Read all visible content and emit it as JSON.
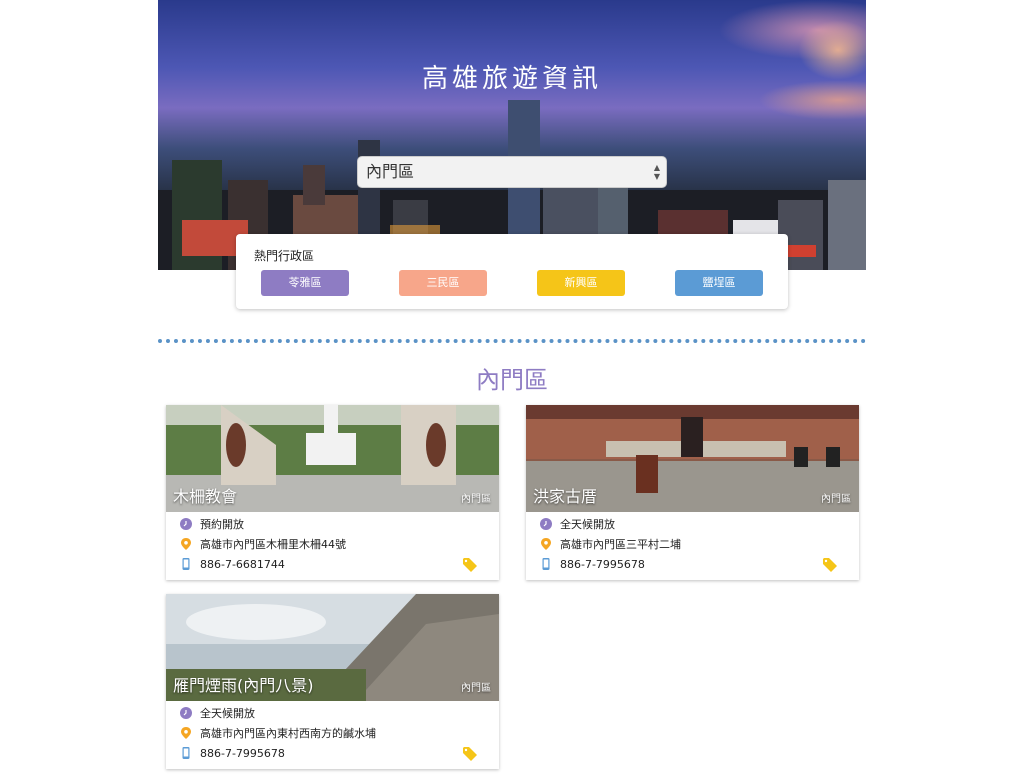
{
  "header": {
    "title": "高雄旅遊資訊",
    "district_select": {
      "selected": "內門區"
    }
  },
  "hot_districts": {
    "title": "熱門行政區",
    "buttons": [
      {
        "label": "苓雅區",
        "color": "#8e7cc3"
      },
      {
        "label": "三民區",
        "color": "#f7a68a"
      },
      {
        "label": "新興區",
        "color": "#f5c518"
      },
      {
        "label": "鹽埕區",
        "color": "#5b9bd5"
      }
    ]
  },
  "section": {
    "title": "內門區"
  },
  "spots": [
    {
      "name": "木柵教會",
      "district": "內門區",
      "open": "預約開放",
      "address": "高雄市內門區木柵里木柵44號",
      "phone": "886-7-6681744"
    },
    {
      "name": "洪家古厝",
      "district": "內門區",
      "open": "全天候開放",
      "address": "高雄市內門區三平村二埔",
      "phone": "886-7-7995678"
    },
    {
      "name": "雁門煙雨(內門八景)",
      "district": "內門區",
      "open": "全天候開放",
      "address": "高雄市內門區內東村西南方的鹹水埔",
      "phone": "886-7-7995678"
    }
  ],
  "colors": {
    "clock": "#8e7cc3",
    "pin": "#f5a623",
    "phone": "#5b9bd5",
    "tag": "#f5c518"
  },
  "icons": {
    "open": "clock-icon",
    "address": "map-pin-icon",
    "phone": "phone-icon",
    "tag": "tag-icon"
  }
}
